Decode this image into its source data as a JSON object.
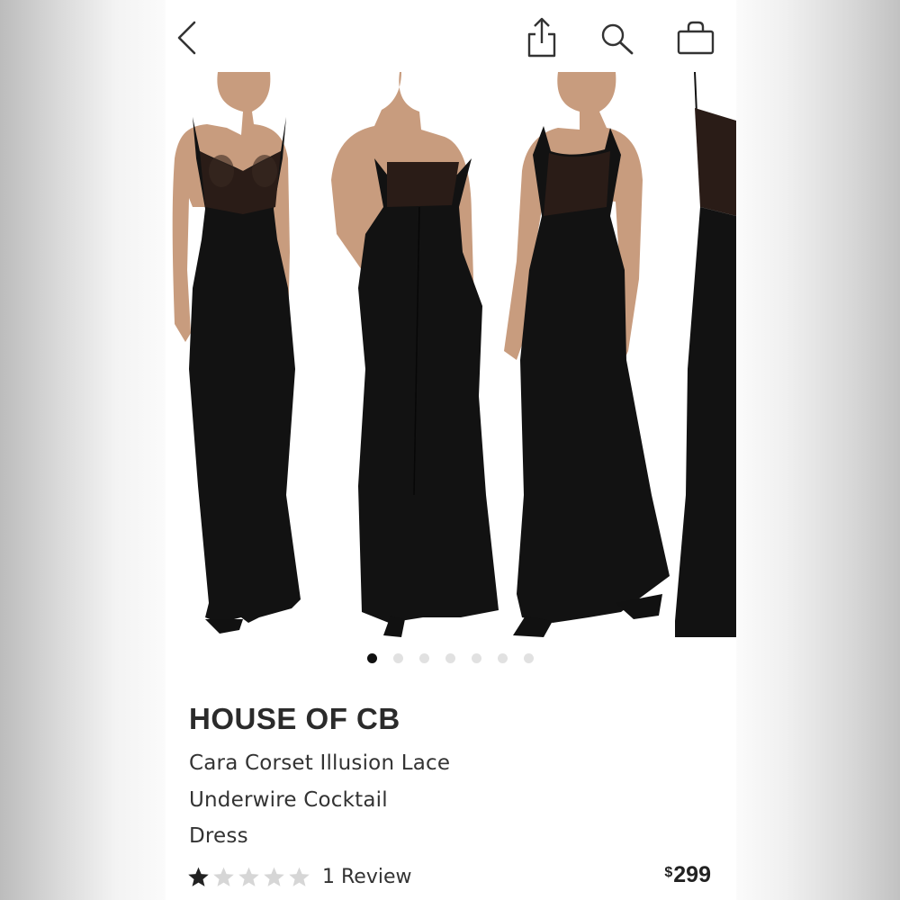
{
  "nav": {
    "icons": [
      "chevron-left-icon",
      "share-icon",
      "search-icon",
      "shopping-bag-icon"
    ]
  },
  "gallery": {
    "total_images": 7,
    "active_index": 0,
    "views": [
      "front",
      "back",
      "three-quarter",
      "side"
    ]
  },
  "product": {
    "brand": "HOUSE OF CB",
    "title_lines": [
      "Cara Corset Illusion Lace",
      "Underwire Cocktail",
      "Dress"
    ],
    "rating": 1,
    "rating_max": 5,
    "reviews_label": "1 Review",
    "price_currency": "$",
    "price_amount": "299"
  },
  "colors": {
    "dress": "#121212",
    "skin": "#c89c7e",
    "star_filled": "#222222",
    "star_empty": "#d6d6d6",
    "dot_active": "#111111",
    "dot_inactive": "#e1e1e1"
  }
}
